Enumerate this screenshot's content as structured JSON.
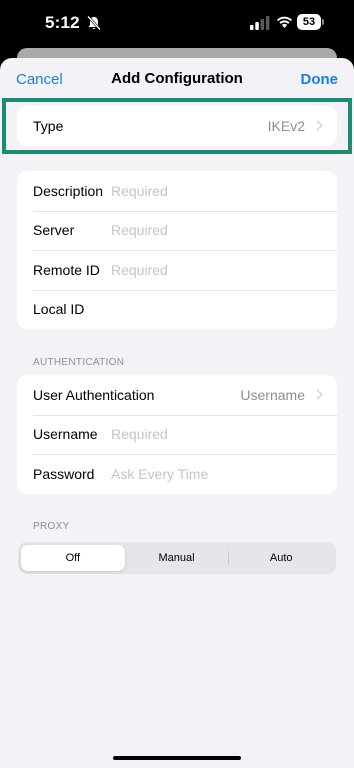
{
  "status_bar": {
    "time": "5:12",
    "battery": "53",
    "icons": [
      "bell-slash-icon",
      "cellular-signal-icon",
      "wifi-icon",
      "battery-icon"
    ]
  },
  "nav": {
    "cancel_label": "Cancel",
    "title": "Add Configuration",
    "done_label": "Done"
  },
  "type_row": {
    "label": "Type",
    "value": "IKEv2"
  },
  "config_group": {
    "rows": [
      {
        "label": "Description",
        "placeholder": "Required"
      },
      {
        "label": "Server",
        "placeholder": "Required"
      },
      {
        "label": "Remote ID",
        "placeholder": "Required"
      },
      {
        "label": "Local ID",
        "placeholder": ""
      }
    ]
  },
  "authentication": {
    "header": "AUTHENTICATION",
    "user_auth_label": "User Authentication",
    "user_auth_value": "Username",
    "username_label": "Username",
    "username_placeholder": "Required",
    "password_label": "Password",
    "password_placeholder": "Ask Every Time"
  },
  "proxy": {
    "header": "PROXY",
    "options": [
      "Off",
      "Manual",
      "Auto"
    ],
    "selected": "Off"
  },
  "colors": {
    "accent": "#1a7ee8",
    "highlight": "#1e8c72",
    "background": "#f2f2f7"
  }
}
